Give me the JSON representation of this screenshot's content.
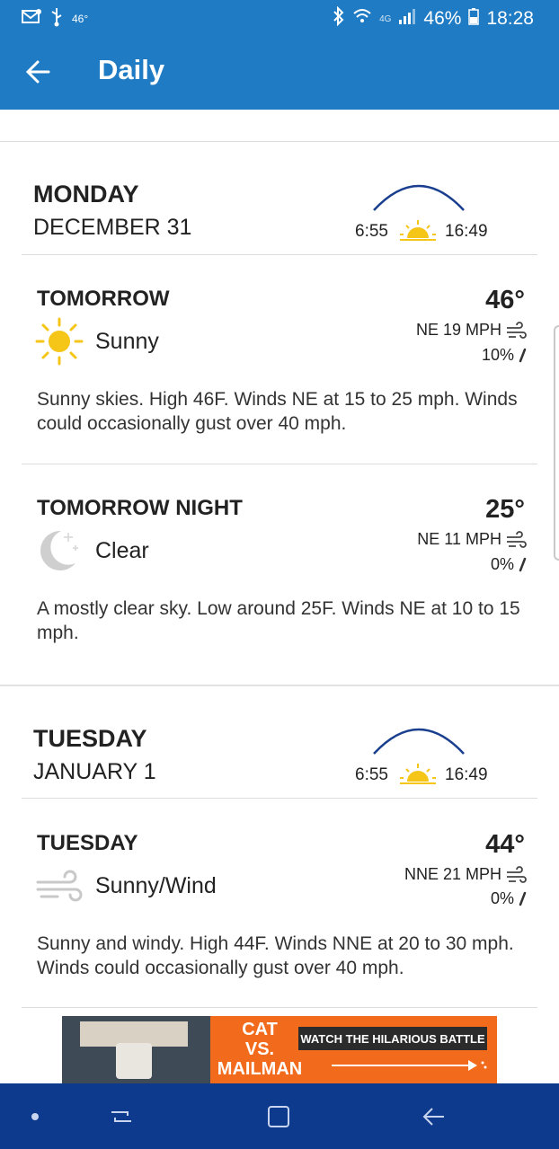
{
  "status_bar": {
    "temperature": "46°",
    "network": "4G",
    "battery": "46%",
    "time": "18:28",
    "left_icons": [
      "mail-icon",
      "usb-icon"
    ],
    "right_icons": [
      "bluetooth-icon",
      "wifi-icon",
      "signal-icon",
      "battery-icon"
    ]
  },
  "app_bar": {
    "title": "Daily",
    "back_icon": "arrow-left-icon"
  },
  "days": [
    {
      "day_name": "MONDAY",
      "date": "DECEMBER 31",
      "sunrise": "6:55",
      "sunset": "16:49",
      "periods": [
        {
          "name": "TOMORROW",
          "temperature": "46°",
          "condition": "Sunny",
          "icon": "sun-icon",
          "wind": "NE 19 MPH",
          "precip": "10%",
          "narrative": "Sunny skies. High 46F. Winds NE at 15 to 25 mph. Winds could occasionally gust over 40 mph."
        },
        {
          "name": "TOMORROW NIGHT",
          "temperature": "25°",
          "condition": "Clear",
          "icon": "moon-icon",
          "wind": "NE 11 MPH",
          "precip": "0%",
          "narrative": "A mostly clear sky. Low around 25F. Winds NE at 10 to 15 mph."
        }
      ]
    },
    {
      "day_name": "TUESDAY",
      "date": "JANUARY 1",
      "sunrise": "6:55",
      "sunset": "16:49",
      "periods": [
        {
          "name": "TUESDAY",
          "temperature": "44°",
          "condition": "Sunny/Wind",
          "icon": "wind-icon",
          "wind": "NNE 21 MPH",
          "precip": "0%",
          "narrative": "Sunny and windy. High 44F. Winds NNE at 20 to 30 mph. Winds could occasionally gust over 40 mph."
        }
      ]
    }
  ],
  "ad": {
    "headline_1": "CAT",
    "headline_2": "VS.",
    "headline_3": "MAILMAN",
    "cta": "WATCH THE HILARIOUS BATTLE"
  },
  "colors": {
    "primary": "#1f7bc4",
    "nav_bar": "#0d3a8c",
    "sun": "#f5c518",
    "arc": "#1a3f8f",
    "ad_orange": "#f26a1b"
  }
}
